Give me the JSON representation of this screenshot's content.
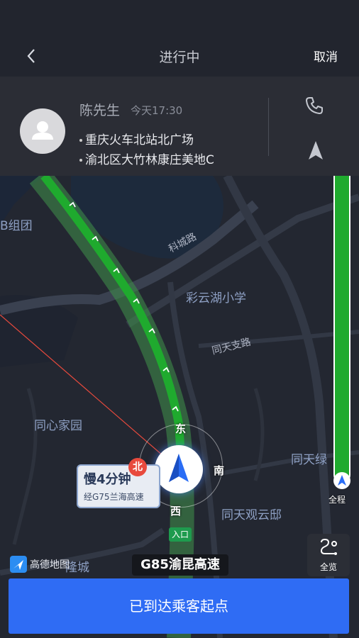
{
  "nav": {
    "title": "进行中",
    "cancel_label": "取消"
  },
  "passenger": {
    "name": "陈先生",
    "time": "今天17:30",
    "pickup": "重庆火车北站北广场",
    "dropoff": "渝北区大竹林康庄美地C"
  },
  "map": {
    "labels": {
      "b_group": "B组团",
      "kecheng_road": "科城路",
      "caiyunhu_school": "彩云湖小学",
      "tongtian_branch": "同天支路",
      "tongxin_garden": "同心家园",
      "tongtian_green": "同天绿",
      "tongtian_guanyun": "同天观云邸",
      "longcheng": "隆城"
    },
    "compass": {
      "north": "北",
      "east": "东",
      "south": "南",
      "west": "西"
    },
    "delay": {
      "main": "慢4分钟",
      "sub": "经G75兰海高速"
    },
    "entry_tag": "入口",
    "current_road": "G85渝昆高速",
    "progress": {
      "label": "全程",
      "completed_fraction": 0.0
    },
    "overview_label": "全览",
    "logo_text": "高德地图",
    "colors": {
      "route": "#1faa2e",
      "accent": "#2f6cf4",
      "background": "#232731"
    }
  },
  "action": {
    "arrive_label": "已到达乘客起点"
  }
}
